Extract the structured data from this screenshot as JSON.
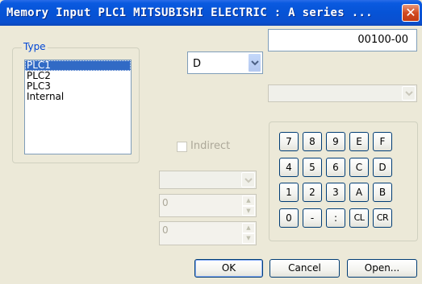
{
  "window": {
    "title": "Memory Input  PLC1 MITSUBISHI ELECTRIC : A series ...",
    "close_symbol": "✕"
  },
  "type_group": {
    "label": "Type",
    "items": [
      {
        "label": "PLC1",
        "selected": true
      },
      {
        "label": "PLC2",
        "selected": false
      },
      {
        "label": "PLC3",
        "selected": false
      },
      {
        "label": "Internal",
        "selected": false
      }
    ]
  },
  "device_combo": {
    "value": "D"
  },
  "address_field": {
    "value": "00100-00"
  },
  "secondary_combo": {
    "value": ""
  },
  "indirect": {
    "label": "Indirect",
    "checked": false,
    "enabled": false
  },
  "indirect_combo": {
    "value": ""
  },
  "spin1": {
    "value": "0"
  },
  "spin2": {
    "value": "0"
  },
  "keypad": {
    "keys": [
      "7",
      "8",
      "9",
      "E",
      "F",
      "4",
      "5",
      "6",
      "C",
      "D",
      "1",
      "2",
      "3",
      "A",
      "B",
      "0",
      "-",
      ":",
      "CL",
      "CR"
    ]
  },
  "buttons": {
    "ok": "OK",
    "cancel": "Cancel",
    "open": "Open..."
  }
}
